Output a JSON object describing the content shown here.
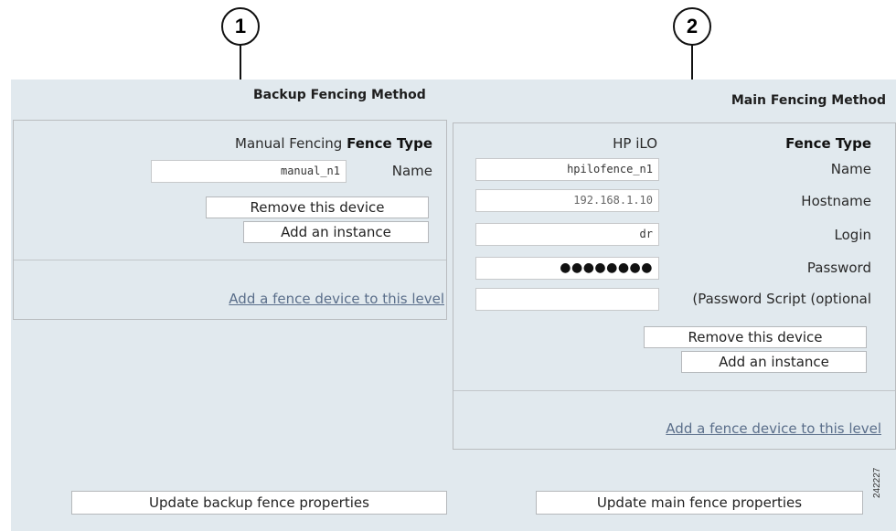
{
  "callouts": [
    "1",
    "2"
  ],
  "backup": {
    "heading": "Backup Fencing Method",
    "fence_type_value": "Manual Fencing",
    "fence_type_label": "Fence Type",
    "name_value": "manual_n1",
    "name_label": "Name",
    "remove_button": "Remove this device",
    "add_instance_button": "Add an instance",
    "add_device_link": "Add a fence device to this level",
    "update_button": "Update backup fence properties"
  },
  "main": {
    "heading": "Main Fencing Method",
    "fence_type_value": "HP iLO",
    "fence_type_label": "Fence Type",
    "fields": [
      {
        "value": "hpilofence_n1",
        "label": "Name"
      },
      {
        "value": "192.168.1.10",
        "label": "Hostname"
      },
      {
        "value": "dr",
        "label": "Login"
      },
      {
        "value": "●●●●●●●●",
        "label": "Password"
      },
      {
        "value": "",
        "label": "(Password Script (optional"
      }
    ],
    "remove_button": "Remove this device",
    "add_instance_button": "Add an instance",
    "add_device_link": "Add a fence device to this level",
    "update_button": "Update main fence properties"
  },
  "figure_id": "242227"
}
